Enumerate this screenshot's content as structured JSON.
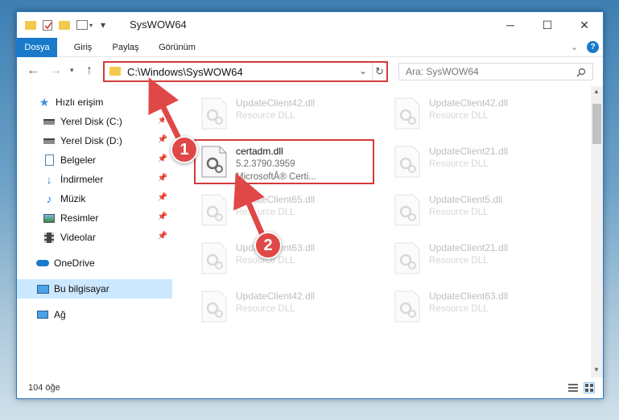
{
  "window": {
    "title": "SysWOW64",
    "minimize_glyph": "─",
    "maximize_glyph": "☐",
    "close_glyph": "✕"
  },
  "ribbon": {
    "tabs": [
      "Dosya",
      "Giriş",
      "Paylaş",
      "Görünüm"
    ],
    "help_glyph": "?"
  },
  "address_bar": {
    "path": "C:\\Windows\\SysWOW64"
  },
  "search": {
    "placeholder": "Ara: SysWOW64"
  },
  "sidebar": {
    "items": [
      {
        "label": "Hızlı erişim",
        "icon": "star-icon",
        "pinned": false
      },
      {
        "label": "Yerel Disk (C:)",
        "icon": "drive-icon",
        "pinned": true
      },
      {
        "label": "Yerel Disk (D:)",
        "icon": "drive-icon",
        "pinned": true
      },
      {
        "label": "Belgeler",
        "icon": "documents-icon",
        "pinned": true
      },
      {
        "label": "İndirmeler",
        "icon": "download-icon",
        "pinned": true
      },
      {
        "label": "Müzik",
        "icon": "music-icon",
        "pinned": true
      },
      {
        "label": "Resimler",
        "icon": "pictures-icon",
        "pinned": true
      },
      {
        "label": "Videolar",
        "icon": "videos-icon",
        "pinned": true
      },
      {
        "label": "OneDrive",
        "icon": "cloud-icon",
        "pinned": false
      },
      {
        "label": "Bu bilgisayar",
        "icon": "computer-icon",
        "pinned": false
      },
      {
        "label": "Ağ",
        "icon": "network-icon",
        "pinned": false
      }
    ]
  },
  "files": [
    {
      "name": "UpdateClient42.dll",
      "meta": "Resource DLL",
      "ghost": true
    },
    {
      "name": "UpdateClient42.dll",
      "meta": "Resource DLL",
      "ghost": true
    },
    {
      "name": "certadm.dll",
      "meta1": "5.2.3790.3959",
      "meta2": "MicrosoftÂ® Certi...",
      "ghost": false
    },
    {
      "name": "UpdateClient21.dll",
      "meta": "Resource DLL",
      "ghost": true
    },
    {
      "name": "UpdateClient65.dll",
      "meta": "Resource DLL",
      "ghost": true
    },
    {
      "name": "UpdateClient5.dll",
      "meta": "Resource DLL",
      "ghost": true
    },
    {
      "name": "UpdateClient63.dll",
      "meta": "Resource DLL",
      "ghost": true
    },
    {
      "name": "UpdateClient21.dll",
      "meta": "Resource DLL",
      "ghost": true
    },
    {
      "name": "UpdateClient42.dll",
      "meta": "Resource DLL",
      "ghost": true
    },
    {
      "name": "UpdateClient63.dll",
      "meta": "Resource DLL",
      "ghost": true
    }
  ],
  "status": {
    "item_count": "104 öğe"
  },
  "callouts": [
    "1",
    "2"
  ],
  "colors": {
    "accent": "#1979ca",
    "highlight_red": "#d23b3b",
    "selected_bg": "#cce8ff"
  }
}
